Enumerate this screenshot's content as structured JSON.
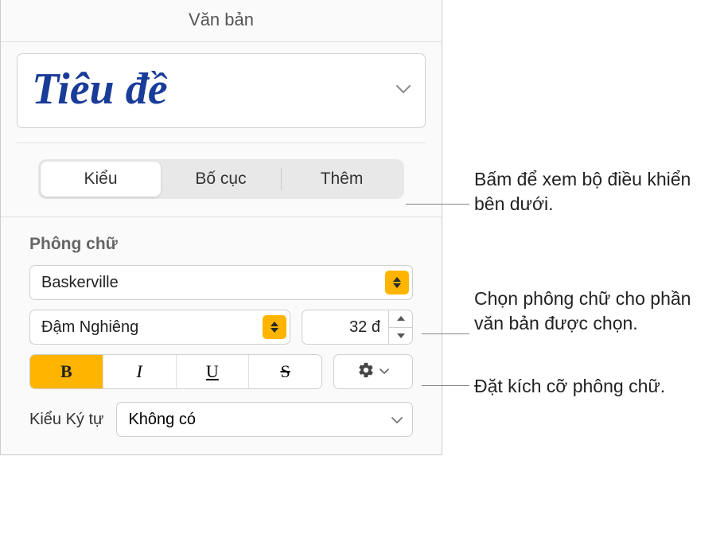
{
  "header": {
    "title": "Văn bản"
  },
  "title_style": {
    "name": "Tiêu đề"
  },
  "tabs": {
    "style": "Kiểu",
    "layout": "Bố cục",
    "more": "Thêm"
  },
  "font": {
    "section_label": "Phông chữ",
    "family": "Baskerville",
    "style": "Đậm Nghiêng",
    "size": "32 đ",
    "bold": "B",
    "italic": "I",
    "underline": "U",
    "strike": "S",
    "char_style_label": "Kiểu Ký tự",
    "char_style_value": "Không có"
  },
  "callouts": {
    "tabs": "Bấm để xem bộ điều khiển bên dưới.",
    "font_family": "Chọn phông chữ cho phần văn bản được chọn.",
    "font_size": "Đặt kích cỡ phông chữ."
  }
}
